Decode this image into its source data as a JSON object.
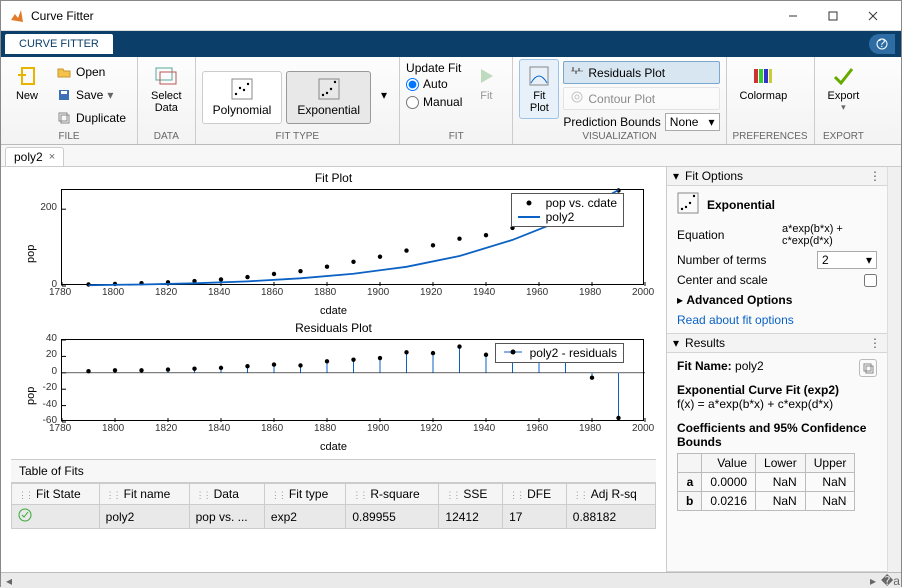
{
  "window": {
    "title": "Curve Fitter"
  },
  "ribbon": {
    "tab": "CURVE FITTER",
    "groups": {
      "file": {
        "label": "FILE",
        "new": "New",
        "open": "Open",
        "save": "Save",
        "duplicate": "Duplicate"
      },
      "data": {
        "label": "DATA",
        "select": "Select\nData"
      },
      "fittype": {
        "label": "FIT TYPE",
        "poly": "Polynomial",
        "exp": "Exponential"
      },
      "fit": {
        "label": "FIT",
        "update": "Update Fit",
        "auto": "Auto",
        "manual": "Manual",
        "fitbtn": "Fit"
      },
      "viz": {
        "label": "VISUALIZATION",
        "fitplot": "Fit\nPlot",
        "residuals": "Residuals Plot",
        "contour": "Contour Plot",
        "predbounds": "Prediction Bounds",
        "predvalue": "None"
      },
      "prefs": {
        "label": "PREFERENCES",
        "colormap": "Colormap"
      },
      "export": {
        "label": "EXPORT",
        "export": "Export"
      }
    }
  },
  "doc_tab": "poly2",
  "fit_options": {
    "title": "Fit Options",
    "type_name": "Exponential",
    "equation_label": "Equation",
    "equation": "a*exp(b*x) + c*exp(d*x)",
    "nterms_label": "Number of terms",
    "nterms_value": "2",
    "center_label": "Center and scale",
    "advanced": "Advanced Options",
    "readlink": "Read about fit options"
  },
  "results": {
    "title": "Results",
    "fitname_label": "Fit Name:",
    "fitname": "poly2",
    "subtitle": "Exponential Curve Fit (exp2)",
    "fx": "f(x) = a*exp(b*x) + c*exp(d*x)",
    "coef_title": "Coefficients and 95% Confidence Bounds",
    "headers": [
      "",
      "Value",
      "Lower",
      "Upper"
    ],
    "rows": [
      {
        "p": "a",
        "v": "0.0000",
        "l": "NaN",
        "u": "NaN"
      },
      {
        "p": "b",
        "v": "0.0216",
        "l": "NaN",
        "u": "NaN"
      }
    ]
  },
  "tof": {
    "title": "Table of Fits",
    "headers": [
      "Fit State",
      "Fit name",
      "Data",
      "Fit type",
      "R-square",
      "SSE",
      "DFE",
      "Adj R-sq"
    ],
    "row": {
      "state": "ok",
      "name": "poly2",
      "data": "pop vs. ...",
      "type": "exp2",
      "r2": "0.89955",
      "sse": "12412",
      "dfe": "17",
      "adjr2": "0.88182"
    }
  },
  "chart_data": [
    {
      "type": "scatter+line",
      "title": "Fit Plot",
      "xlabel": "cdate",
      "ylabel": "pop",
      "xlim": [
        1780,
        2000
      ],
      "ylim": [
        0,
        250
      ],
      "xticks": [
        1780,
        1800,
        1820,
        1840,
        1860,
        1880,
        1900,
        1920,
        1940,
        1960,
        1980,
        2000
      ],
      "yticks": [
        0,
        200
      ],
      "series": [
        {
          "name": "pop vs. cdate",
          "kind": "scatter",
          "x": [
            1790,
            1800,
            1810,
            1820,
            1830,
            1840,
            1850,
            1860,
            1870,
            1880,
            1890,
            1900,
            1910,
            1920,
            1930,
            1940,
            1950,
            1960,
            1970,
            1980,
            1990
          ],
          "y": [
            3.9,
            5.3,
            7.2,
            9.6,
            12.9,
            17.1,
            23.2,
            31.4,
            38.6,
            50.2,
            63.0,
            76.2,
            92.2,
            106.0,
            123.2,
            132.2,
            151.3,
            179.3,
            203.3,
            226.5,
            248.7
          ]
        },
        {
          "name": "poly2",
          "kind": "line",
          "x": [
            1790,
            1810,
            1830,
            1850,
            1870,
            1890,
            1910,
            1930,
            1950,
            1970,
            1990
          ],
          "y": [
            2,
            4,
            7,
            12,
            20,
            32,
            50,
            78,
            120,
            175,
            250
          ]
        }
      ]
    },
    {
      "type": "stem",
      "title": "Residuals Plot",
      "xlabel": "cdate",
      "ylabel": "pop",
      "xlim": [
        1780,
        2000
      ],
      "ylim": [
        -60,
        40
      ],
      "xticks": [
        1780,
        1800,
        1820,
        1840,
        1860,
        1880,
        1900,
        1920,
        1940,
        1960,
        1980,
        2000
      ],
      "yticks": [
        -60,
        -40,
        -20,
        0,
        20,
        40
      ],
      "series": [
        {
          "name": "poly2 - residuals",
          "x": [
            1790,
            1800,
            1810,
            1820,
            1830,
            1840,
            1850,
            1860,
            1870,
            1880,
            1890,
            1900,
            1910,
            1920,
            1930,
            1940,
            1950,
            1960,
            1970,
            1980,
            1990
          ],
          "y": [
            2,
            3,
            3,
            4,
            5,
            6,
            8,
            10,
            9,
            14,
            16,
            18,
            25,
            24,
            32,
            22,
            28,
            32,
            26,
            -6,
            -55
          ]
        }
      ]
    }
  ]
}
